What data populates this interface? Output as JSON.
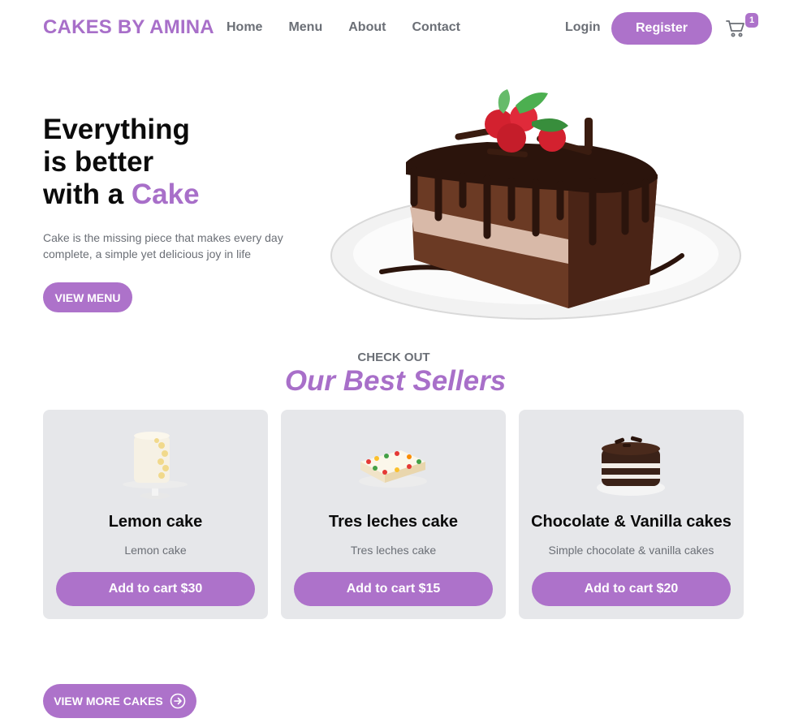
{
  "header": {
    "brand": "CAKES BY AMINA",
    "nav": [
      "Home",
      "Menu",
      "About",
      "Contact"
    ],
    "login": "Login",
    "register": "Register",
    "cart_count": "1"
  },
  "hero": {
    "title_line1": "Everything",
    "title_line2": "is better",
    "title_line3_prefix": "with a ",
    "title_accent": "Cake",
    "description": "Cake is the missing piece that makes every day complete, a simple yet delicious joy in life",
    "cta": "VIEW MENU"
  },
  "best_sellers": {
    "eyebrow": "CHECK OUT",
    "heading": "Our Best Sellers",
    "products": [
      {
        "name": "Lemon cake",
        "description": "Lemon cake",
        "button": "Add to cart $30"
      },
      {
        "name": "Tres leches cake",
        "description": "Tres leches cake",
        "button": "Add to cart $15"
      },
      {
        "name": "Chocolate & Vanilla cakes",
        "description": "Simple chocolate & vanilla cakes",
        "button": "Add to cart $20"
      }
    ],
    "view_more": "VIEW MORE CAKES"
  },
  "colors": {
    "accent": "#ad72ca",
    "card_bg": "#e6e7ea",
    "muted_text": "#6b6f76"
  },
  "icons": {
    "cart": "shopping-cart-icon",
    "view_more": "arrow-right-circle-icon"
  }
}
